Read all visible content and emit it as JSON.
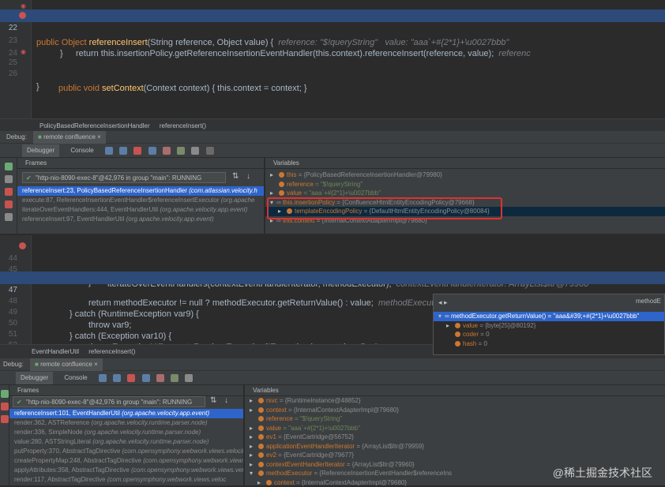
{
  "top_editor": {
    "lines": [
      {
        "num": "21",
        "pre": "public Object ",
        "fn": "referenceInsert",
        "post": "(String reference, Object value) {",
        "hint": "reference: \"$!queryString\"   value: \"aaa`+#{2*1}+\\u0027bbb\""
      },
      {
        "num": "22",
        "text": "return this.insertionPolicy.getReferenceInsertionEventHandler(this.context).referenceInsert(reference, value);",
        "hint": "referenc"
      },
      {
        "num": "23",
        "text": "}"
      },
      {
        "num": "24",
        "text": ""
      },
      {
        "num": "25",
        "pre": "public void ",
        "fn": "setContext",
        "post": "(Context context) { this.context = context; }"
      },
      {
        "num": "26",
        "text": "}"
      }
    ],
    "breadcrumb": [
      "PolicyBasedReferenceInsertionHandler",
      "referenceInsert()"
    ]
  },
  "debug_top": {
    "label": "Debug:",
    "session_tab": "remote confluence",
    "tabs": [
      "Debugger",
      "Console"
    ],
    "frames_header": "Frames",
    "variables_header": "Variables",
    "thread": "\"http-nio-8090-exec-8\"@42,976 in group \"main\": RUNNING",
    "frames": [
      {
        "text": "referenceInsert:23, PolicyBasedReferenceInsertionHandler",
        "pkg": "(com.atlassian.velocity.h"
      },
      {
        "text": "execute:87, ReferenceInsertionEventHandler$referenceInsertExecutor",
        "pkg": "(org.apache"
      },
      {
        "text": "iterateOverEventHandlers:444, EventHandlerUtil",
        "pkg": "(org.apache.velocity.app.event)"
      },
      {
        "text": "referenceInsert:97, EventHandlerUtil",
        "pkg": "(org.apache.velocity.app.event)"
      }
    ],
    "variables": [
      {
        "name": "this",
        "value": "= {PolicyBasedReferenceInsertionHandler@79980}",
        "expand": "▸"
      },
      {
        "name": "reference",
        "value": "= \"$!queryString\"",
        "expand": ""
      },
      {
        "name": "value",
        "value": "= \"aaa`+#{2*1}+\\u0027bbb\"",
        "expand": "▸"
      },
      {
        "name": "this.insertionPolicy",
        "value": "= {ConfluenceHtmlEntityEncodingPolicy@79668}",
        "expand": "▾"
      },
      {
        "name": "templateEncodingPolicy",
        "value": "= {DefaultHtmlEntityEncodingPolicy@80084}",
        "expand": "▸"
      },
      {
        "name": "this.context",
        "value": "= {InternalContextAdapterImpl@79680}",
        "expand": "▸"
      }
    ]
  },
  "bottom_editor": {
    "lines": [
      {
        "num": "44",
        "text": "iterateOverEventHandlers(contextEventHandlerIterator, methodExecutor);",
        "hint": "contextEventHandlerIterator: ArrayList$Itr@79960"
      },
      {
        "num": "45",
        "text": "}"
      },
      {
        "num": "46",
        "text": ""
      },
      {
        "num": "47",
        "text": "return methodExecutor != null ? methodExecutor.getReturnValue() : value;",
        "hint": "methodExecutor: ReferenceInsertionEventHandler$refer"
      },
      {
        "num": "48",
        "text": "} catch (RuntimeException var9) {"
      },
      {
        "num": "49",
        "text": "throw var9;"
      },
      {
        "num": "50",
        "text": "} catch (Exception var10) {"
      },
      {
        "num": "51",
        "text": "throw ExceptionUtils.createRuntimeException(\"Exception in event handler.\", v"
      },
      {
        "num": "52",
        "text": "}"
      }
    ],
    "breadcrumb": [
      "EventHandlerUtil",
      "referenceInsert()"
    ]
  },
  "popup": {
    "title": "methodE",
    "root": "methodExecutor.getReturnValue() = \"aaa&#39;+#{2*1}+\\u0027bbb\"",
    "children": [
      {
        "name": "value",
        "value": "= {byte[25]@80192}"
      },
      {
        "name": "coder",
        "value": "= 0"
      },
      {
        "name": "hash",
        "value": "= 0"
      }
    ]
  },
  "debug_bottom": {
    "label": "Debug:",
    "session_tab": "remote confluence",
    "tabs": [
      "Debugger",
      "Console"
    ],
    "frames_header": "Frames",
    "variables_header": "Variables",
    "thread": "\"http-nio-8090-exec-8\"@42,976 in group \"main\": RUNNING",
    "frames": [
      {
        "text": "referenceInsert:101, EventHandlerUtil",
        "pkg": "(org.apache.velocity.app.event)"
      },
      {
        "text": "render:362, ASTReference",
        "pkg": "(org.apache.velocity.runtime.parser.node)"
      },
      {
        "text": "render:336, SimpleNode",
        "pkg": "(org.apache.velocity.runtime.parser.node)"
      },
      {
        "text": "value:280, ASTStringLiteral",
        "pkg": "(org.apache.velocity.runtime.parser.node)"
      },
      {
        "text": "putProperty:370, AbstractTagDirective",
        "pkg": "(com.opensymphony.webwork.views.velocit"
      },
      {
        "text": "createPropertyMap:248, AbstractTagDirective",
        "pkg": "(com.opensymphony.webwork.views.velo"
      },
      {
        "text": "applyAttributes:358, AbstractTagDirective",
        "pkg": "(com.opensymphony.webwork.views.vel"
      },
      {
        "text": "render:117, AbstractTagDirective",
        "pkg": "(com.opensymphony.webwork.views.veloc"
      }
    ],
    "variables": [
      {
        "name": "rsvc",
        "value": "= {RuntimeInstance@48852}"
      },
      {
        "name": "context",
        "value": "= {InternalContextAdapterImpl@79680}"
      },
      {
        "name": "reference",
        "value": "= \"$!queryString\""
      },
      {
        "name": "value",
        "value": "= \"aaa`+#{2*1}+\\u0027bbb\""
      },
      {
        "name": "ev1",
        "value": "= {EventCartridge@56752}"
      },
      {
        "name": "applicationEventHandlerIterator",
        "value": "= {ArrayList$Itr@79959}"
      },
      {
        "name": "ev2",
        "value": "= {EventCartridge@79677}"
      },
      {
        "name": "contextEventHandlerIterator",
        "value": "= {ArrayList$Itr@79960}"
      },
      {
        "name": "methodExecutor",
        "value": "= {ReferenceInsertionEventHandler$referenceIns"
      },
      {
        "name": "context",
        "value": "= {InternalContextAdapterImpl@79680}"
      }
    ]
  },
  "watermark": "@稀土掘金技术社区"
}
